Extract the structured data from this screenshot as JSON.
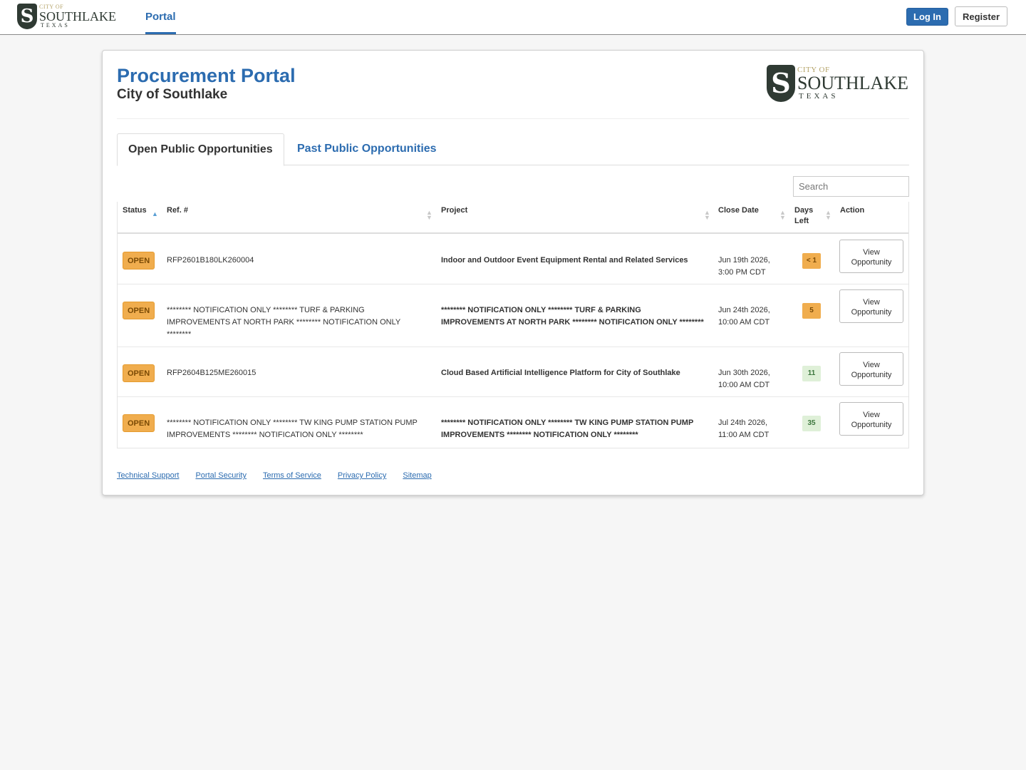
{
  "nav": {
    "brand": {
      "city": "CITY OF",
      "name": "SOUTHLAKE",
      "state": "TEXAS"
    },
    "portal_link": "Portal",
    "login_label": "Log In",
    "register_label": "Register"
  },
  "header": {
    "title": "Procurement Portal",
    "subtitle": "City of Southlake",
    "logo": {
      "city": "CITY OF",
      "name": "SOUTHLAKE",
      "state": "TEXAS"
    }
  },
  "tabs": [
    {
      "label": "Open Public Opportunities",
      "active": true
    },
    {
      "label": "Past Public Opportunities",
      "active": false
    }
  ],
  "search": {
    "placeholder": "Search",
    "value": ""
  },
  "table": {
    "columns": [
      "Status",
      "Ref. #",
      "Project",
      "Close Date",
      "Days Left",
      "Action"
    ],
    "days_left_header": [
      "Days",
      "Left"
    ],
    "rows": [
      {
        "status": "OPEN",
        "ref": "RFP2601B180LK260004",
        "project": "Indoor and Outdoor Event Equipment Rental and Related Services",
        "close_date": "Jun 19th 2026, 3:00 PM CDT",
        "days_left": "< 1",
        "days_color": "#f0ad4e",
        "action": [
          "View",
          "Opportunity"
        ]
      },
      {
        "status": "OPEN",
        "ref": "******** NOTIFICATION ONLY ******** TURF & PARKING IMPROVEMENTS AT NORTH PARK ******** NOTIFICATION ONLY ********",
        "project": "******** NOTIFICATION ONLY ******** TURF & PARKING IMPROVEMENTS AT NORTH PARK ******** NOTIFICATION ONLY ********",
        "close_date": "Jun 24th 2026, 10:00 AM CDT",
        "days_left": "5",
        "days_color": "#f0ad4e",
        "action": [
          "View",
          "Opportunity"
        ]
      },
      {
        "status": "OPEN",
        "ref": "RFP2604B125ME260015",
        "project": "Cloud Based Artificial Intelligence Platform for City of Southlake",
        "close_date": "Jun 30th 2026, 10:00 AM CDT",
        "days_left": "11",
        "days_color": "#dff0d8",
        "action": [
          "View",
          "Opportunity"
        ]
      },
      {
        "status": "OPEN",
        "ref": "******** NOTIFICATION ONLY ******** TW KING PUMP STATION PUMP IMPROVEMENTS ******** NOTIFICATION ONLY ********",
        "project": "******** NOTIFICATION ONLY ******** TW KING PUMP STATION PUMP IMPROVEMENTS ******** NOTIFICATION ONLY ********",
        "close_date": "Jul 24th 2026, 11:00 AM CDT",
        "days_left": "35",
        "days_color": "#dff0d8",
        "action": [
          "View",
          "Opportunity"
        ]
      }
    ]
  },
  "footer_links": [
    "Technical Support",
    "Portal Security",
    "Terms of Service",
    "Privacy Policy",
    "Sitemap"
  ]
}
